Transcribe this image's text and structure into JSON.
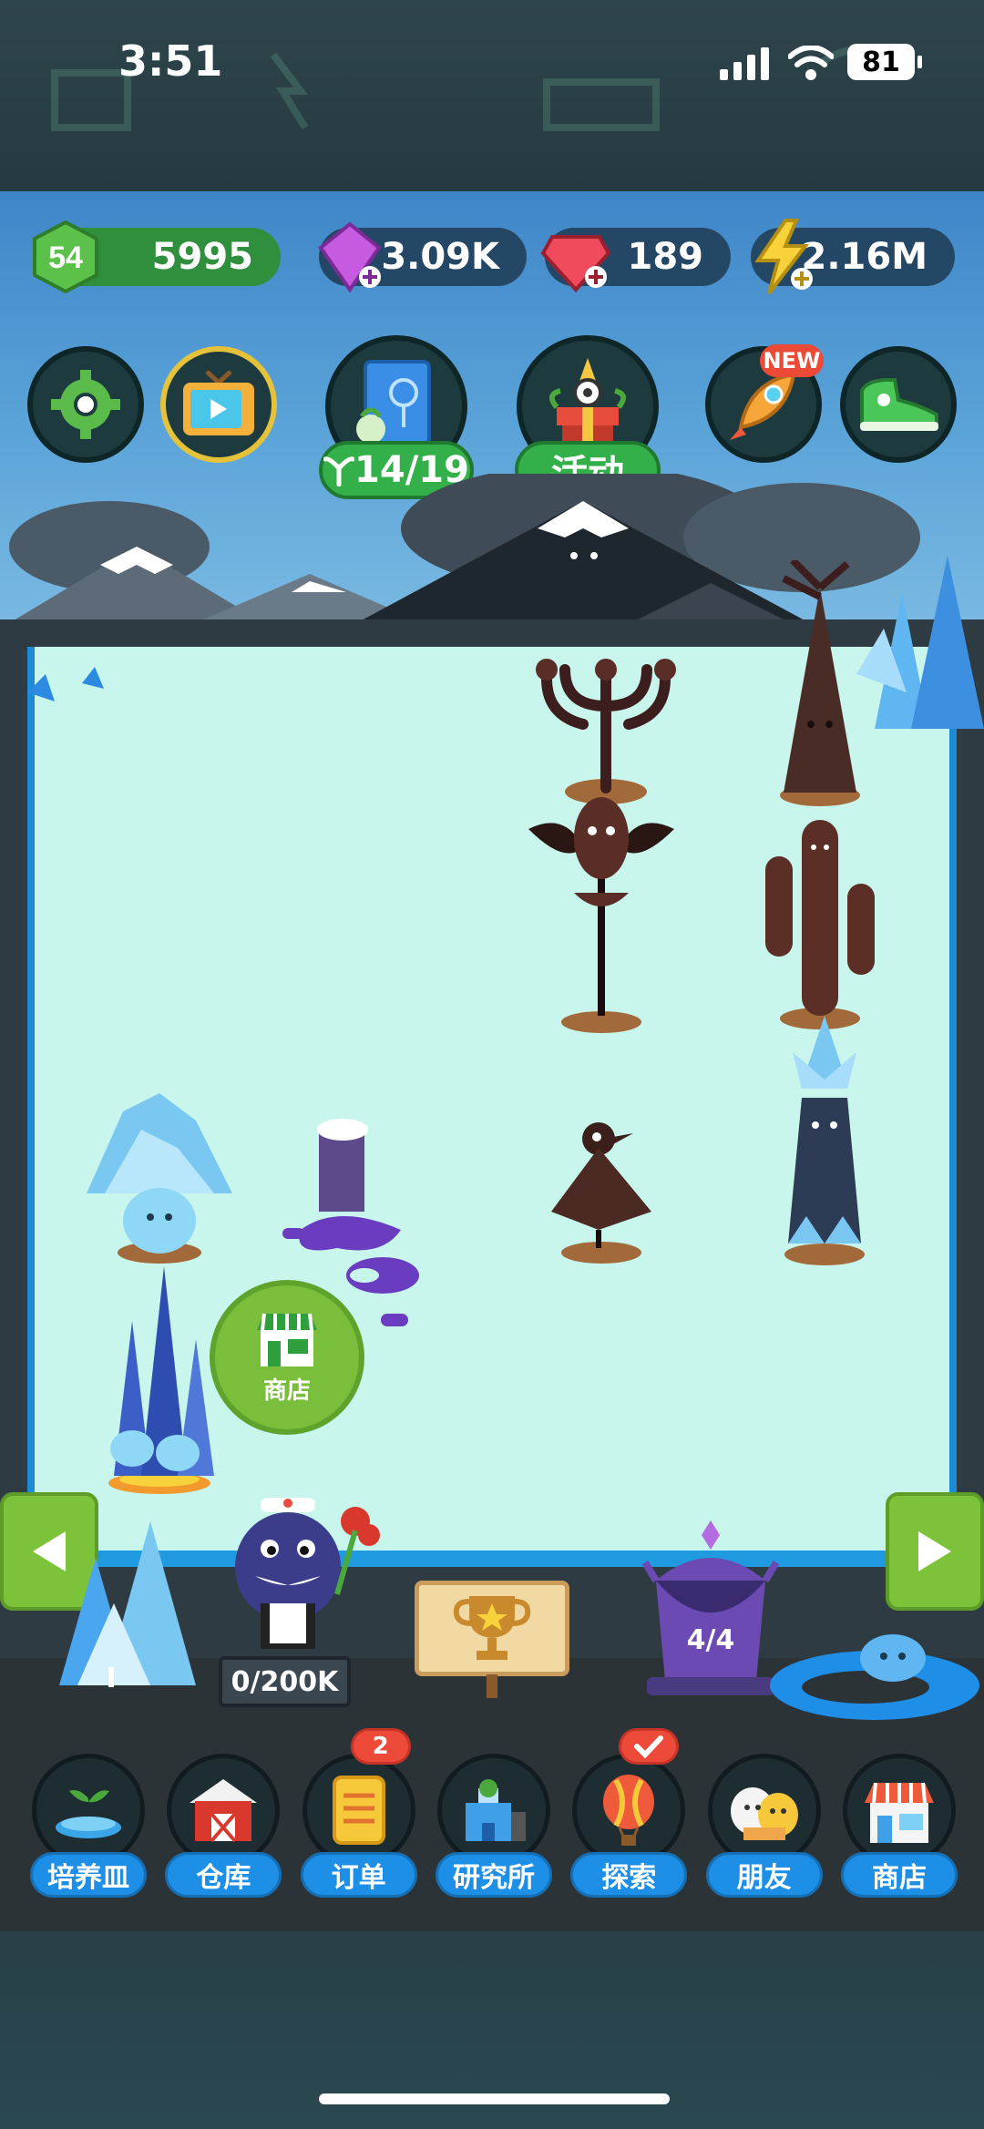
{
  "status_bar": {
    "time": "3:51",
    "battery": "81",
    "icons": [
      "signal-icon",
      "wifi-icon",
      "battery-icon"
    ]
  },
  "resources": {
    "level": "54",
    "coins": "5995",
    "purple_gems": "3.09K",
    "red_gems": "189",
    "energy": "2.16M"
  },
  "top_buttons": {
    "plant_book_count": "14/19",
    "event_label": "活动",
    "new_badge": "NEW"
  },
  "garden": {
    "shop_label": "商店",
    "maid_counter": "0/200K",
    "cage_counter": "4/4"
  },
  "dock": {
    "items": [
      {
        "label": "培养皿",
        "icon": "petri-dish-icon"
      },
      {
        "label": "仓库",
        "icon": "barn-icon"
      },
      {
        "label": "订单",
        "icon": "order-scroll-icon",
        "badge": "2"
      },
      {
        "label": "研究所",
        "icon": "lab-icon"
      },
      {
        "label": "探索",
        "icon": "balloon-icon"
      },
      {
        "label": "朋友",
        "icon": "friends-icon"
      },
      {
        "label": "商店",
        "icon": "shop-icon"
      }
    ]
  },
  "colors": {
    "sky": "#5aa3d8",
    "floor": "#c9f6ec",
    "green_button": "#7cc33a",
    "dock_label": "#1e8fe6",
    "badge_red": "#ee4a3a"
  }
}
